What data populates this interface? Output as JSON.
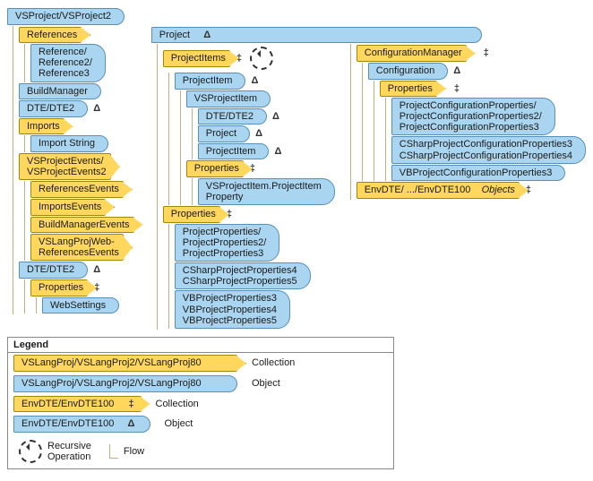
{
  "root": {
    "vsproject": "VSProject/VSProject2"
  },
  "col1": {
    "references": "References",
    "references_children": "Reference/\nReference2/\nReference3",
    "build_manager": "BuildManager",
    "dte_dte2": "DTE/DTE2",
    "imports": "Imports",
    "import_string": "Import String",
    "events": "VSProjectEvents/\nVSProjectEvents2",
    "references_events": "ReferencesEvents",
    "imports_events": "ImportsEvents",
    "buildmanager_events": "BuildManagerEvents",
    "vslangprojweb_events": "VSLangProjWeb-\nReferencesEvents",
    "dte_dte2b": "DTE/DTE2",
    "properties": "Properties",
    "websettings": "WebSettings"
  },
  "col2": {
    "project": "Project",
    "project_items": "ProjectItems",
    "project_item": "ProjectItem",
    "vsprojectitem": "VSProjectItem",
    "dte_dte2": "DTE/DTE2",
    "project_child": "Project",
    "project_item_child": "ProjectItem",
    "properties": "Properties",
    "vsprojitem_prop": "VSProjectItem.ProjectItem\nProperty",
    "properties2": "Properties",
    "projprops": "ProjectProperties/\nProjectProperties2/\nProjectProperties3",
    "csprops": "CSharpProjectProperties4\nCSharpProjectProperties5",
    "vbprops": "VBProjectProperties3\nVBProjectProperties4\nVBProjectProperties5"
  },
  "col3": {
    "config_mgr": "ConfigurationManager",
    "configuration": "Configuration",
    "properties": "Properties",
    "projcfg": "ProjectConfigurationProperties/\nProjectConfigurationProperties2/\nProjectConfigurationProperties3",
    "cscfg": "CSharpProjectConfigurationProperties3\nCSharpProjectConfigurationProperties4",
    "vbcfg": "VBProjectConfigurationProperties3",
    "envdte": "EnvDTE/ .../EnvDTE100",
    "envdte_objects": "Objects"
  },
  "legend": {
    "title": "Legend",
    "r1_label": "VSLangProj/VSLangProj2/VSLangProj80",
    "r1_desc": "Collection",
    "r2_label": "VSLangProj/VSLangProj2/VSLangProj80",
    "r2_desc": "Object",
    "r3_label": "EnvDTE/EnvDTE100",
    "r3_desc": "Collection",
    "r4_label": "EnvDTE/EnvDTE100",
    "r4_desc": "Object",
    "recursive": "Recursive\nOperation",
    "flow": "Flow"
  },
  "symbols": {
    "delta": "Δ",
    "ddagger": "‡"
  }
}
